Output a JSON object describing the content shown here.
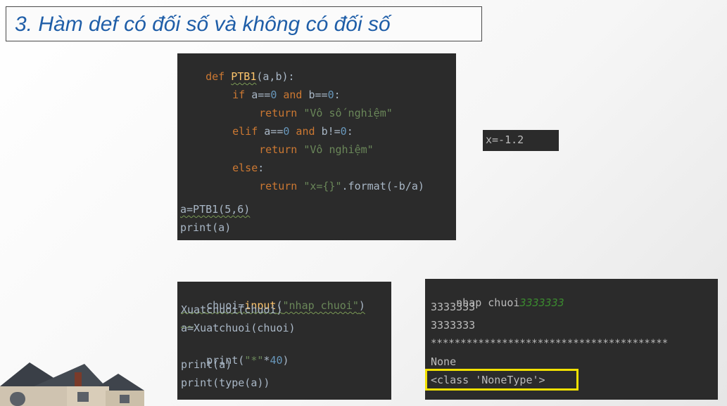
{
  "slide": {
    "title": "3. Hàm def có đối số và không có đối số"
  },
  "code_top": {
    "lines": [
      {
        "kw": "def ",
        "fn": "PTB1",
        "rest": "(a,b):"
      },
      {
        "kw": "if ",
        "a": "a==",
        "num1": "0",
        "and": " and ",
        "b": "b==",
        "num2": "0",
        "end": ":"
      },
      {
        "kw": "return ",
        "str": "\"Vô số nghiệm\""
      },
      {
        "kw": "elif ",
        "a": "a==",
        "num1": "0",
        "and": " and ",
        "b": "b!=",
        "num2": "0",
        "end": ":"
      },
      {
        "kw": "return ",
        "str": "\"Vô nghiệm\""
      },
      {
        "kw": "else",
        "end": ":"
      },
      {
        "kw": "return ",
        "str": "\"x={}\"",
        "rest": ".format(-b/a)"
      },
      {
        "text": "a=PTB1(5,6)"
      },
      {
        "text": "print(a)"
      }
    ]
  },
  "output_top": {
    "text": "x=-1.2"
  },
  "code_bottom": {
    "lines": [
      {
        "a": "chuoi=",
        "fn": "input",
        "b": "(",
        "str": "\"nhap chuoi\"",
        "c": ")"
      },
      {
        "text": "Xuatchuoi(chuoi)"
      },
      {
        "text": "a=Xuatchuoi(chuoi)"
      },
      {
        "a": "print(",
        "str": "\"*\"",
        "b": "*",
        "num": "40",
        "c": ")"
      },
      {
        "text": "print(a)"
      },
      {
        "text": "print(type(a))"
      }
    ]
  },
  "output_bottom": {
    "prompt": "nhap chuoi",
    "typed": "3333333",
    "lines": [
      "3333333",
      "3333333",
      "****************************************",
      "None",
      "<class 'NoneType'>"
    ]
  },
  "colors": {
    "title": "#1f5ea8",
    "editor_bg": "#2b2b2b",
    "keyword": "#cc7832",
    "string": "#6a8759",
    "number": "#6897bb",
    "function": "#ffc66d",
    "highlight_box": "#f2e100"
  }
}
